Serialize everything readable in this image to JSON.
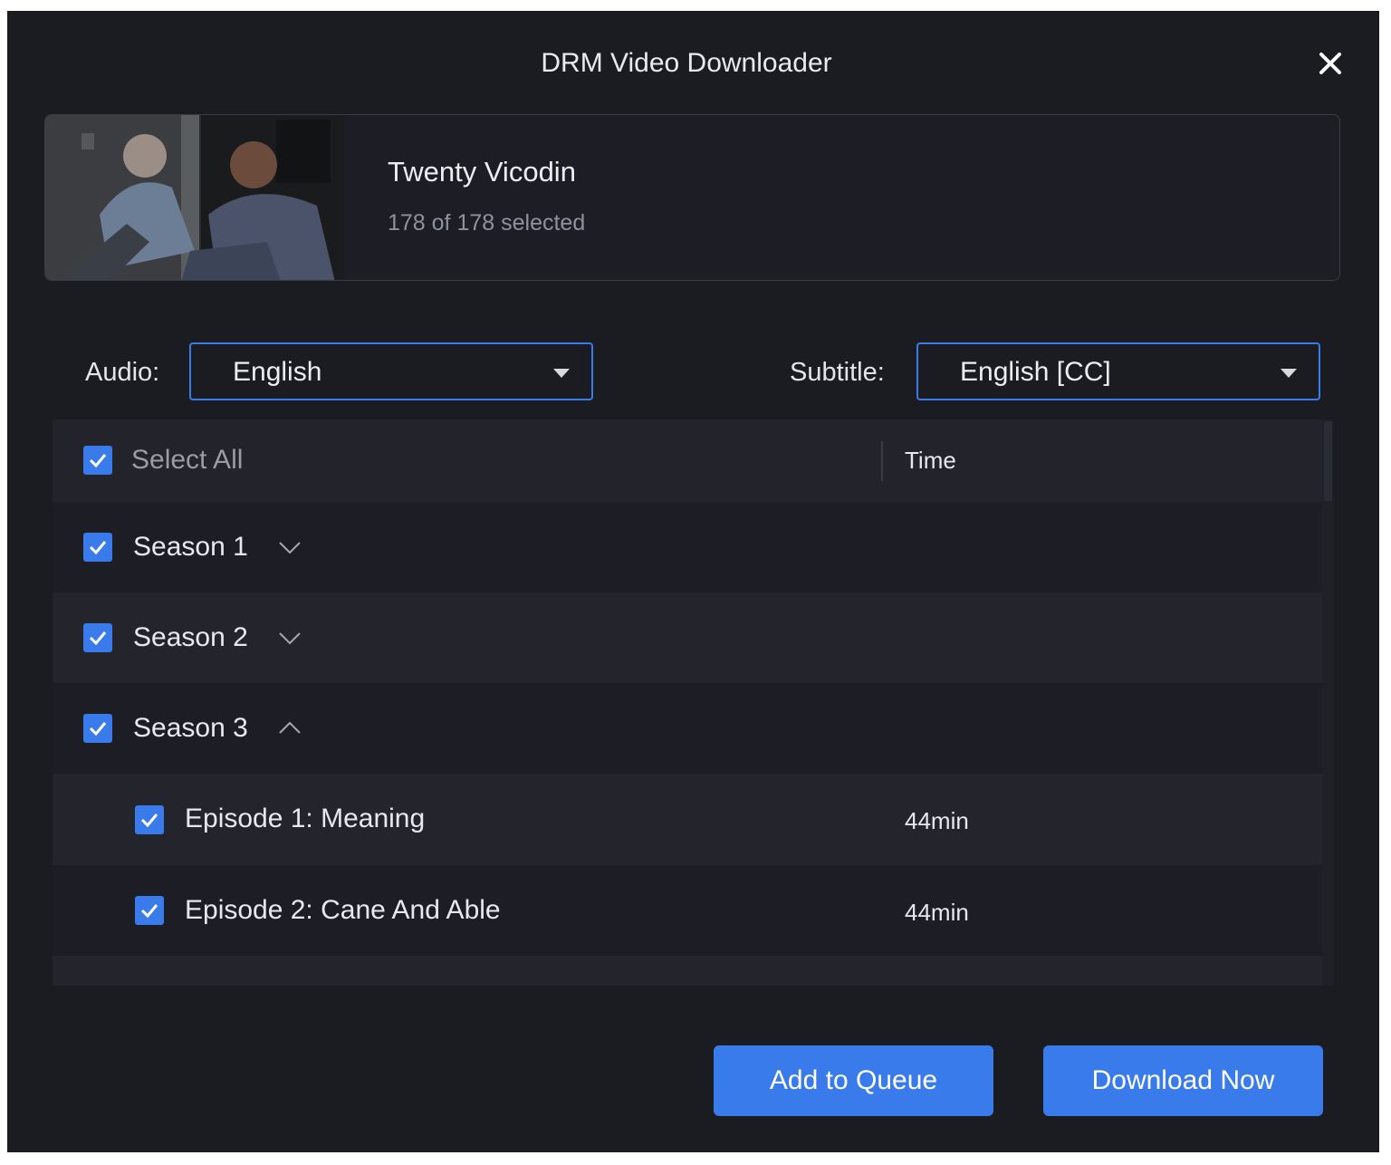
{
  "window": {
    "title": "DRM Video Downloader"
  },
  "show": {
    "title": "Twenty Vicodin",
    "selection": "178 of 178 selected"
  },
  "audio": {
    "label": "Audio:",
    "value": "English"
  },
  "subtitle": {
    "label": "Subtitle:",
    "value": "English [CC]"
  },
  "table": {
    "select_all_label": "Select All",
    "time_header": "Time",
    "seasons": [
      {
        "label": "Season 1",
        "expanded": false,
        "checked": true
      },
      {
        "label": "Season 2",
        "expanded": false,
        "checked": true
      },
      {
        "label": "Season 3",
        "expanded": true,
        "checked": true
      }
    ],
    "episodes": [
      {
        "title": "Episode 1: Meaning",
        "time": "44min",
        "checked": true
      },
      {
        "title": "Episode 2: Cane And Able",
        "time": "44min",
        "checked": true
      }
    ]
  },
  "buttons": {
    "add_to_queue": "Add to Queue",
    "download_now": "Download Now"
  },
  "colors": {
    "accent": "#3a7bec",
    "background": "#1b1c22",
    "row_alt": "#23242c"
  }
}
